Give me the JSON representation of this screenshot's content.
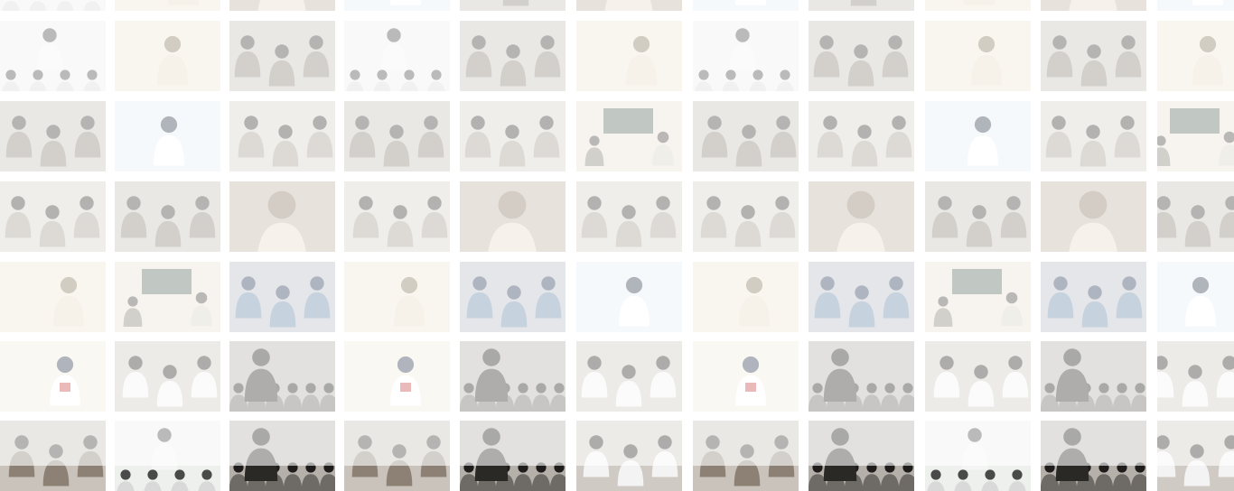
{
  "gallery": {
    "title": "",
    "scene_types": [
      {
        "name": "presenter-seated-audience",
        "bg": "#eef0ee",
        "fg": "#4a4a4a",
        "accent": "#d9d9d9"
      },
      {
        "name": "speaker-light-room",
        "bg": "#efe6d6",
        "fg": "#8a7b62",
        "accent": "#e8dcc7"
      },
      {
        "name": "group-activity",
        "bg": "#c9c3bb",
        "fg": "#3d3a36",
        "accent": "#8d8175"
      },
      {
        "name": "speaker-whiteboard",
        "bg": "#e4eef7",
        "fg": "#2f3e4a",
        "accent": "#ffffff"
      },
      {
        "name": "discussion-circle",
        "bg": "#d7d2cb",
        "fg": "#3a3530",
        "accent": "#a59c91"
      },
      {
        "name": "screen-presentation",
        "bg": "#e9e2d4",
        "fg": "#4a463f",
        "accent": "#5d6f62"
      },
      {
        "name": "portrait-close",
        "bg": "#bfb3a1",
        "fg": "#3b3328",
        "accent": "#e6dccb"
      },
      {
        "name": "workshop-blue",
        "bg": "#b8bec7",
        "fg": "#2c3d5a",
        "accent": "#6a8aa6"
      },
      {
        "name": "speaker-podium",
        "bg": "#f1ecde",
        "fg": "#2f3a52",
        "accent": "#c84a4a"
      },
      {
        "name": "dark-audience",
        "bg": "#b5b0aa",
        "fg": "#1f1d1b",
        "accent": "#6e6a66"
      },
      {
        "name": "speaker-gesture",
        "bg": "#cfcac3",
        "fg": "#2a2724",
        "accent": "#f3f3f3"
      }
    ],
    "rows": [
      [
        0,
        1,
        6,
        3,
        2,
        6,
        3,
        2,
        1,
        6,
        3
      ],
      [
        0,
        1,
        2,
        0,
        2,
        1,
        0,
        2,
        1,
        2,
        1
      ],
      [
        2,
        3,
        4,
        2,
        4,
        5,
        2,
        4,
        3,
        4,
        5
      ],
      [
        4,
        2,
        6,
        4,
        6,
        4,
        4,
        6,
        2,
        6,
        2
      ],
      [
        1,
        5,
        7,
        1,
        7,
        3,
        1,
        7,
        5,
        7,
        3
      ],
      [
        8,
        10,
        9,
        8,
        9,
        10,
        8,
        9,
        10,
        9,
        10
      ],
      [
        2,
        0,
        9,
        2,
        9,
        10,
        2,
        9,
        0,
        9,
        10
      ]
    ]
  }
}
